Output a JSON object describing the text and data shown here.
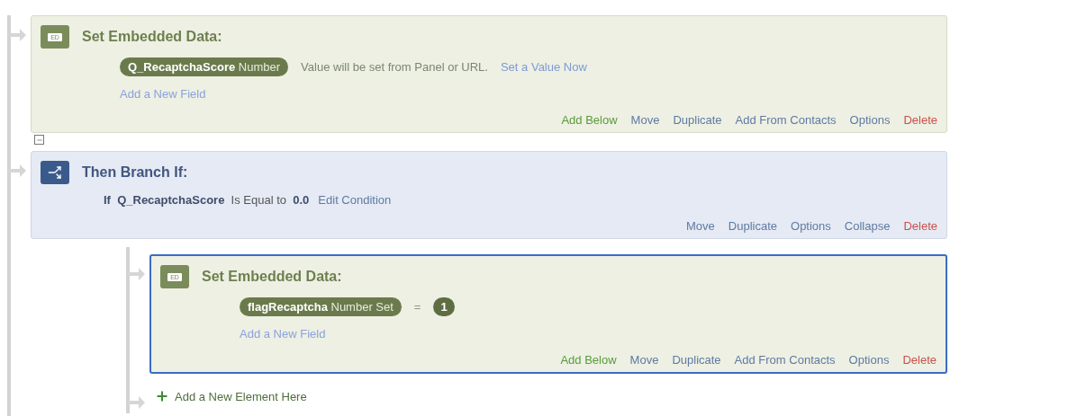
{
  "flow": [
    {
      "kind": "embedded",
      "badge": "ED",
      "title": "Set Embedded Data:",
      "selected": false,
      "fields": [
        {
          "label": "**Q_RecaptchaScore** Number",
          "note": "Value will be set from Panel or URL.",
          "link": "Set a Value Now"
        }
      ],
      "add_field": "Add a New Field",
      "actions": [
        {
          "kind": "add",
          "label": "Add Below"
        },
        {
          "kind": "link",
          "label": "Move"
        },
        {
          "kind": "link",
          "label": "Duplicate"
        },
        {
          "kind": "link",
          "label": "Add From Contacts"
        },
        {
          "kind": "link",
          "label": "Options"
        },
        {
          "kind": "delete",
          "label": "Delete"
        }
      ]
    },
    {
      "kind": "branch",
      "title": "Then Branch If:",
      "selected": false,
      "expanded": true,
      "condition": "**If  Q_RecaptchaScore**  Is Equal to  **0.0**",
      "condition_link": "Edit Condition",
      "actions": [
        {
          "kind": "link",
          "label": "Move"
        },
        {
          "kind": "link",
          "label": "Duplicate"
        },
        {
          "kind": "link",
          "label": "Options"
        },
        {
          "kind": "link",
          "label": "Collapse"
        },
        {
          "kind": "delete",
          "label": "Delete"
        }
      ],
      "children": [
        {
          "kind": "embedded",
          "badge": "ED",
          "title": "Set Embedded Data:",
          "selected": true,
          "fields": [
            {
              "label": "**flagRecaptcha** Number Set",
              "operator": "=",
              "value": "1"
            }
          ],
          "add_field": "Add a New Field",
          "actions": [
            {
              "kind": "add",
              "label": "Add Below"
            },
            {
              "kind": "link",
              "label": "Move"
            },
            {
              "kind": "link",
              "label": "Duplicate"
            },
            {
              "kind": "link",
              "label": "Add From Contacts"
            },
            {
              "kind": "link",
              "label": "Options"
            },
            {
              "kind": "delete",
              "label": "Delete"
            }
          ]
        }
      ],
      "add_element": "Add a New Element Here"
    }
  ]
}
